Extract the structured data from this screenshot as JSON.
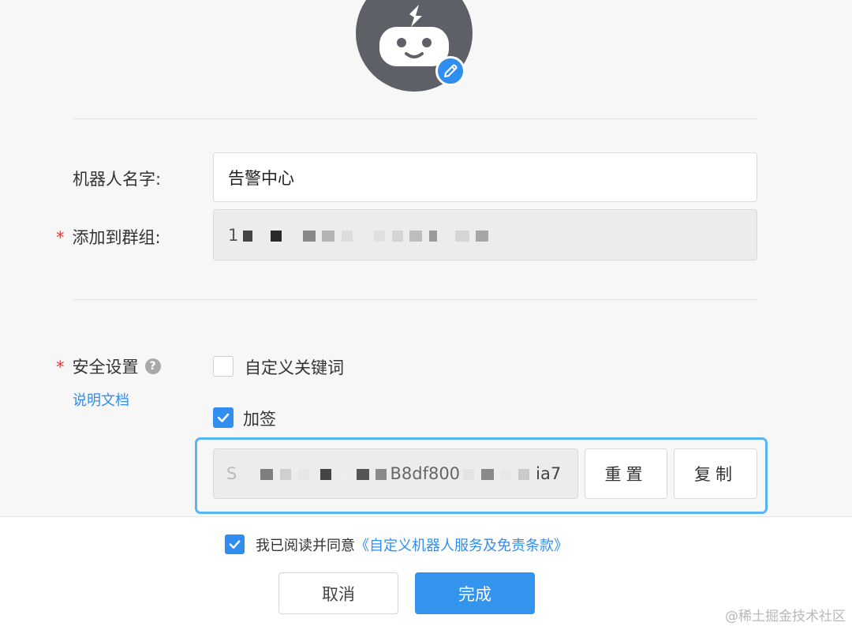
{
  "form": {
    "robot_name_label": "机器人名字:",
    "robot_name_value": "告警中心",
    "group_required_mark": "*",
    "group_label": "添加到群组:",
    "group_value_visible": "1",
    "security_required_mark": "*",
    "security_label": "安全设置",
    "help_icon_glyph": "?",
    "doc_link": "说明文档",
    "keyword_option": "自定义关键词",
    "keyword_checked": false,
    "sign_option": "加签",
    "sign_checked": true,
    "secret_prefix": "S",
    "secret_mid": "B8df800",
    "secret_suffix": "ia7",
    "reset_button": "重置",
    "copy_button": "复制"
  },
  "footer": {
    "agree_checked": true,
    "agree_text": "我已阅读并同意",
    "terms_link": "《自定义机器人服务及免责条款》",
    "cancel_button": "取消",
    "done_button": "完成"
  },
  "watermark": "@稀土掘金技术社区",
  "colors": {
    "accent": "#2f8ef0",
    "required": "#e53935",
    "highlight_border": "#55b6f3",
    "avatar_bg": "#5d6066"
  },
  "icons": {
    "avatar": "robot-icon",
    "edit": "pencil-icon",
    "help": "question-icon",
    "check": "checkmark-icon"
  }
}
